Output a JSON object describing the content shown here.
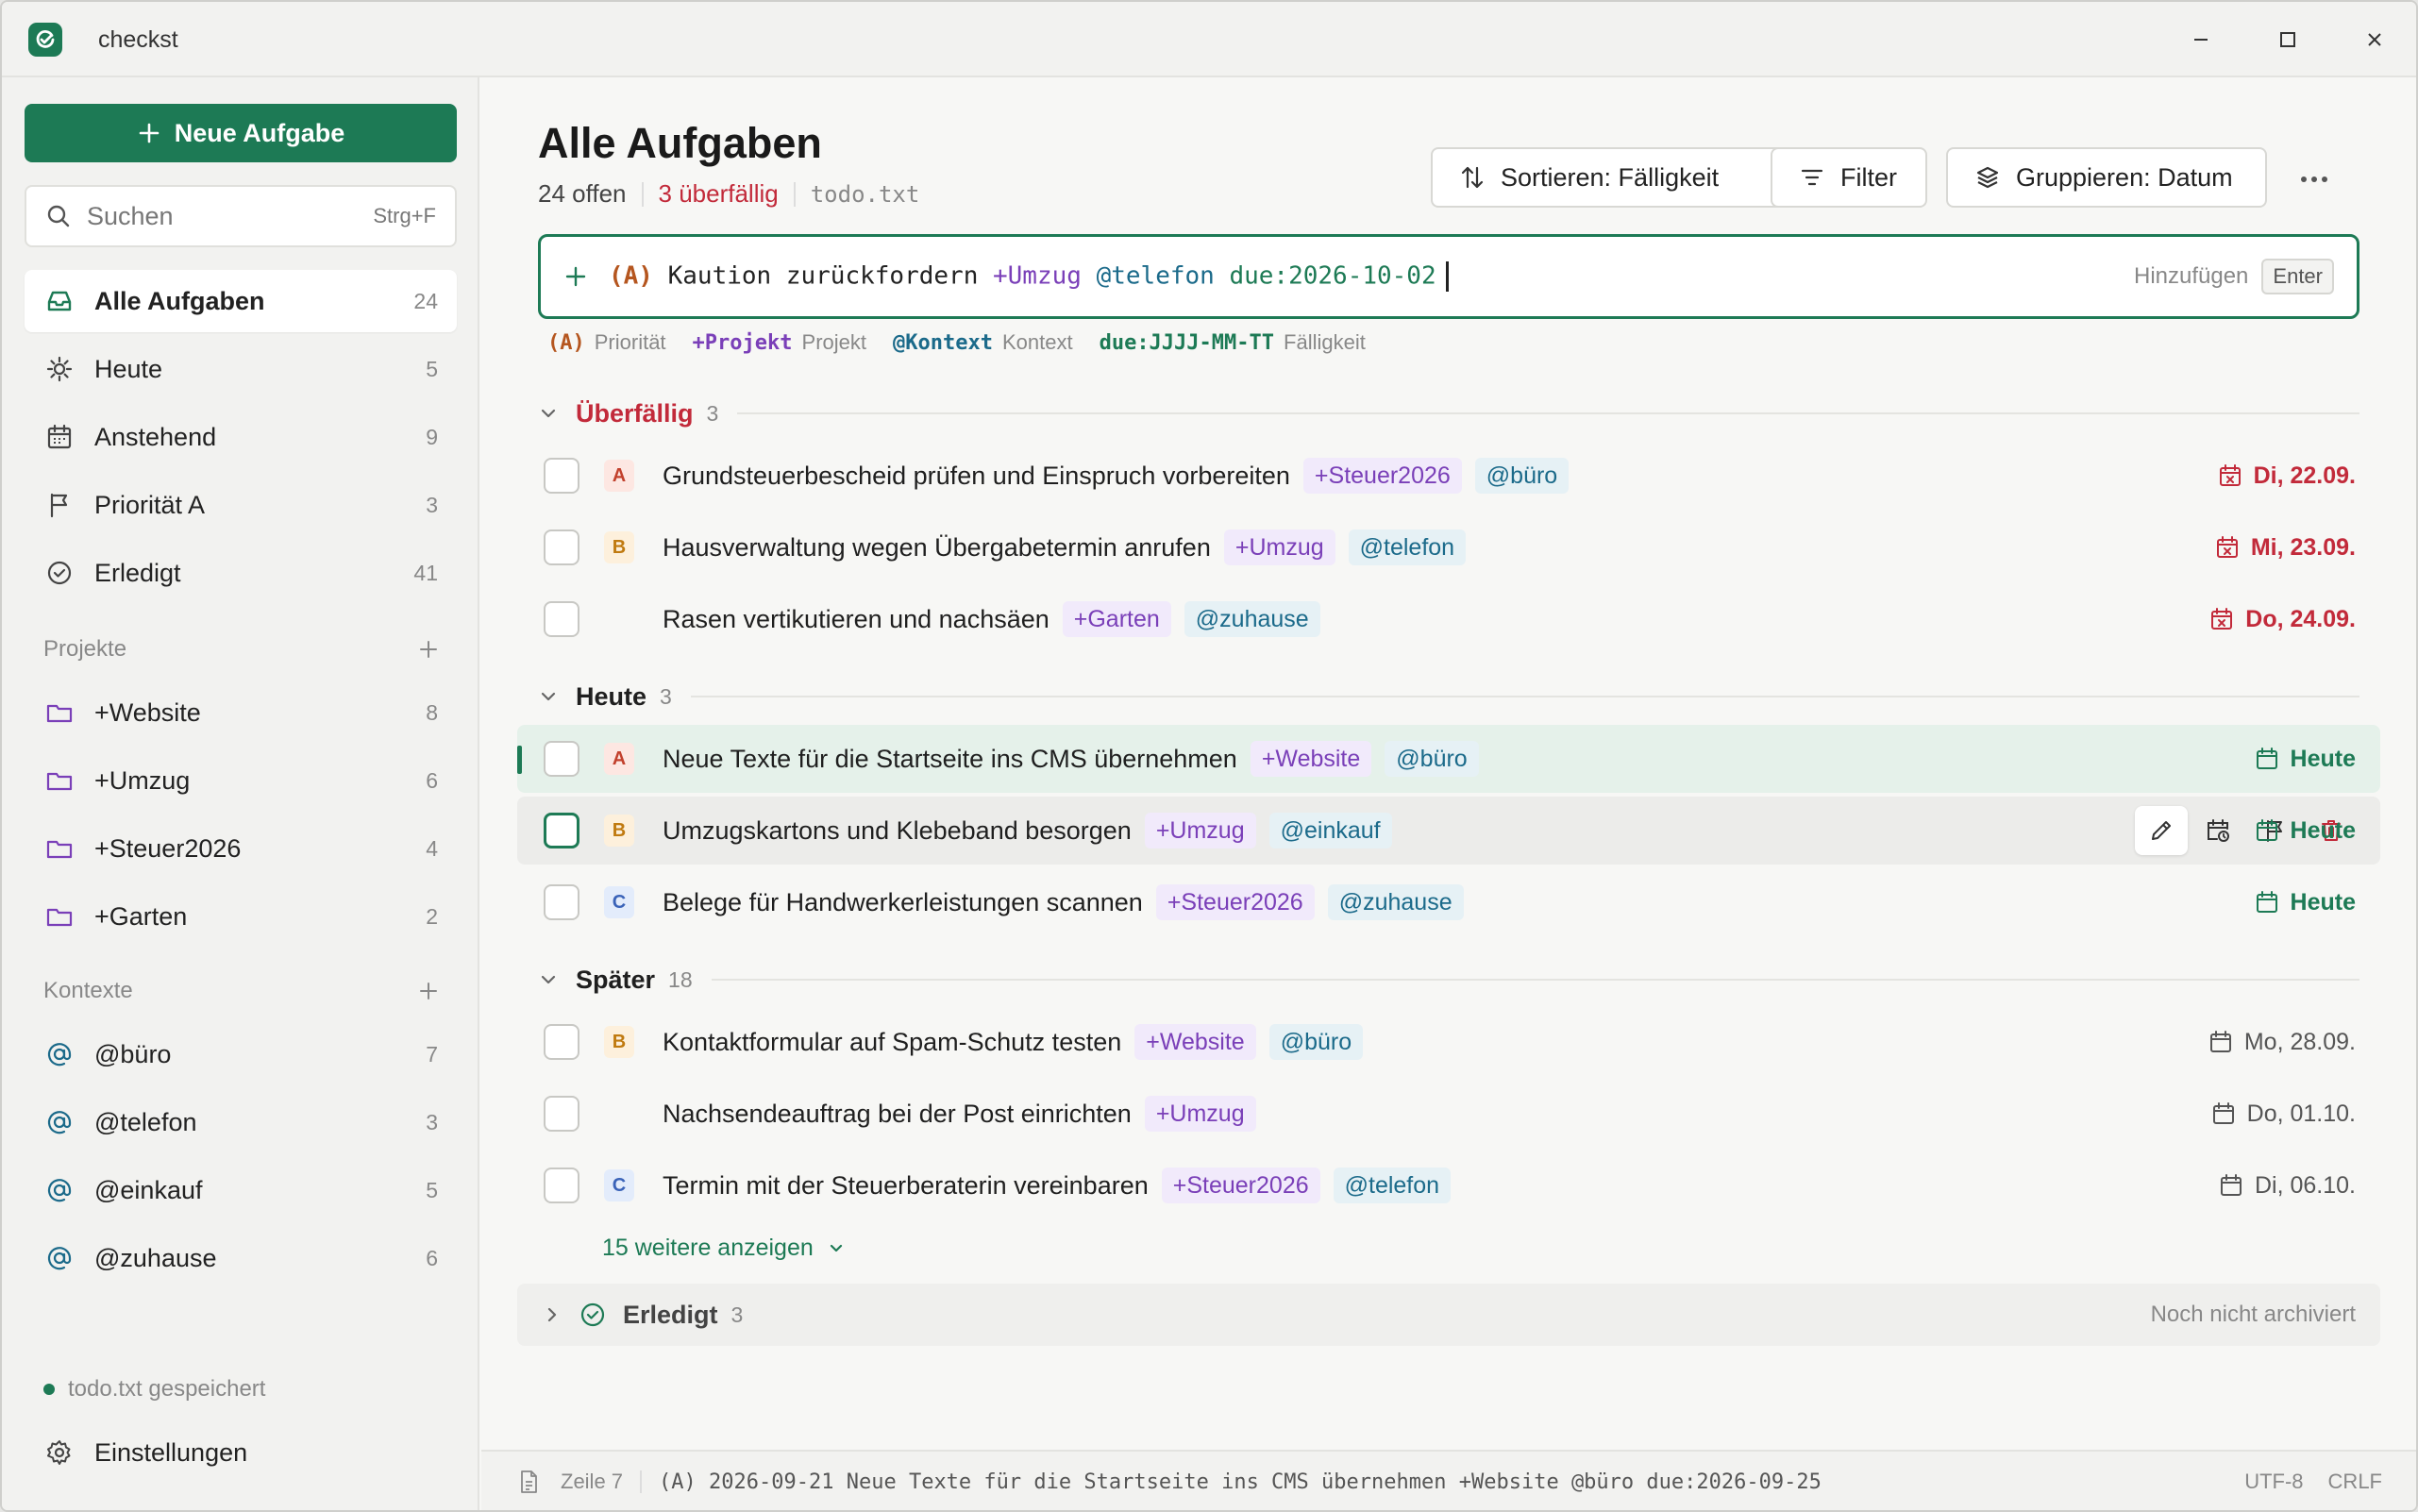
{
  "app": {
    "title": "checkst",
    "accent": "#1d7a55"
  },
  "sidebar": {
    "new_task_label": "Neue Aufgabe",
    "search": {
      "placeholder": "Suchen",
      "shortcut": "Strg+F"
    },
    "nav": [
      {
        "label": "Alle Aufgaben",
        "count": "24",
        "icon": "inbox-icon",
        "active": true
      },
      {
        "label": "Heute",
        "count": "5",
        "icon": "sun-icon"
      },
      {
        "label": "Anstehend",
        "count": "9",
        "icon": "calendar-icon"
      },
      {
        "label": "Priorität A",
        "count": "3",
        "icon": "flag-icon"
      },
      {
        "label": "Erledigt",
        "count": "41",
        "icon": "check-circle-icon"
      }
    ],
    "projects_heading": "Projekte",
    "projects": [
      {
        "label": "+Website",
        "count": "8"
      },
      {
        "label": "+Umzug",
        "count": "6"
      },
      {
        "label": "+Steuer2026",
        "count": "4"
      },
      {
        "label": "+Garten",
        "count": "2"
      }
    ],
    "contexts_heading": "Kontexte",
    "contexts": [
      {
        "label": "@büro",
        "count": "7"
      },
      {
        "label": "@telefon",
        "count": "3"
      },
      {
        "label": "@einkauf",
        "count": "5"
      },
      {
        "label": "@zuhause",
        "count": "6"
      }
    ],
    "saved_status": "todo.txt gespeichert",
    "settings_label": "Einstellungen"
  },
  "main": {
    "title": "Alle Aufgaben",
    "open_count": "24 offen",
    "overdue_count": "3 überfällig",
    "file": "todo.txt",
    "toolbar": {
      "sort_label": "Sortieren: Fälligkeit",
      "filter_label": "Filter",
      "group_label": "Gruppieren: Datum"
    },
    "quick_add": {
      "prio": "(A)",
      "text": " Kaution zurückfordern ",
      "project": "+Umzug",
      "context": "@telefon",
      "due": "due:2026-10-02",
      "add_label": "Hinzufügen",
      "enter_key": "Enter"
    },
    "hints": [
      {
        "token": "(A)",
        "label": "Priorität",
        "kind": "prio"
      },
      {
        "token": "+Projekt",
        "label": "Projekt",
        "kind": "proj"
      },
      {
        "token": "@Kontext",
        "label": "Kontext",
        "kind": "ctx"
      },
      {
        "token": "due:JJJJ-MM-TT",
        "label": "Fälligkeit",
        "kind": "due"
      }
    ],
    "groups": {
      "overdue": {
        "label": "Überfällig",
        "count": "3"
      },
      "today": {
        "label": "Heute",
        "count": "3"
      },
      "later": {
        "label": "Später",
        "count": "18"
      }
    },
    "tasks_overdue": [
      {
        "prio": "A",
        "text": "Grundsteuerbescheid prüfen und Einspruch vorbereiten",
        "project": "+Steuer2026",
        "context": "@büro",
        "due": "Di, 22.09."
      },
      {
        "prio": "B",
        "text": "Hausverwaltung wegen Übergabetermin anrufen",
        "project": "+Umzug",
        "context": "@telefon",
        "due": "Mi, 23.09."
      },
      {
        "prio": "",
        "text": "Rasen vertikutieren und nachsäen",
        "project": "+Garten",
        "context": "@zuhause",
        "due": "Do, 24.09."
      }
    ],
    "tasks_today": [
      {
        "prio": "A",
        "text": "Neue Texte für die Startseite ins CMS übernehmen",
        "project": "+Website",
        "context": "@büro",
        "due": "Heute"
      },
      {
        "prio": "B",
        "text": "Umzugskartons und Klebeband besorgen",
        "project": "+Umzug",
        "context": "@einkauf",
        "due": "Heute"
      },
      {
        "prio": "C",
        "text": "Belege für Handwerkerleistungen scannen",
        "project": "+Steuer2026",
        "context": "@zuhause",
        "due": "Heute"
      }
    ],
    "tasks_later": [
      {
        "prio": "B",
        "text": "Kontaktformular auf Spam-Schutz testen",
        "project": "+Website",
        "context": "@büro",
        "due": "Mo, 28.09."
      },
      {
        "prio": "",
        "text": "Nachsendeauftrag bei der Post einrichten",
        "project": "+Umzug",
        "context": "",
        "due": "Do, 01.10."
      },
      {
        "prio": "C",
        "text": "Termin mit der Steuerberaterin vereinbaren",
        "project": "+Steuer2026",
        "context": "@telefon",
        "due": "Di, 06.10."
      }
    ],
    "show_more": "15 weitere anzeigen",
    "done": {
      "label": "Erledigt",
      "count": "3",
      "note": "Noch nicht archiviert"
    }
  },
  "statusbar": {
    "line": "Zeile 7",
    "raw": "(A) 2026-09-21 Neue Texte für die Startseite ins CMS übernehmen +Website @büro due:2026-09-25",
    "encoding": "UTF-8",
    "eol": "CRLF"
  }
}
